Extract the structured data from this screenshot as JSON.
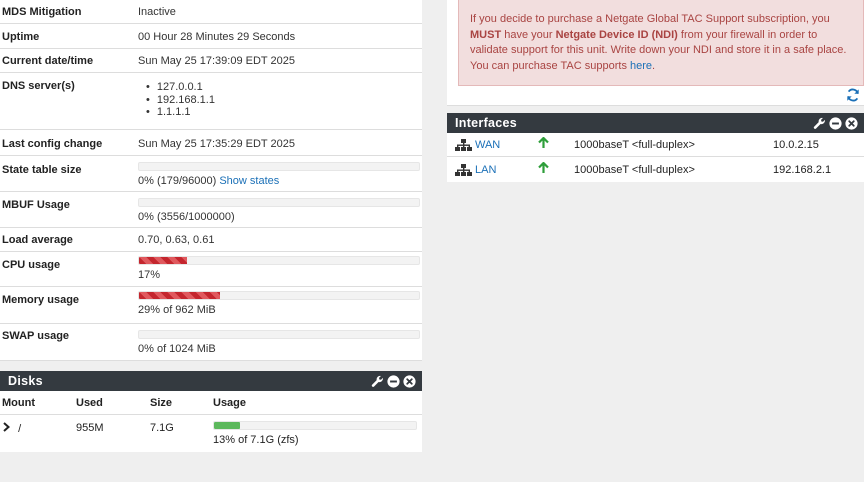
{
  "sysinfo": {
    "rows": [
      {
        "label": "MDS Mitigation",
        "value": "Inactive"
      },
      {
        "label": "Uptime",
        "value": "00 Hour 28 Minutes 29 Seconds"
      },
      {
        "label": "Current date/time",
        "value": "Sun May 25 17:39:09 EDT 2025"
      },
      {
        "label": "DNS server(s)",
        "dns": [
          "127.0.0.1",
          "192.168.1.1",
          "1.1.1.1"
        ]
      },
      {
        "label": "Last config change",
        "value": "Sun May 25 17:35:29 EDT 2025"
      },
      {
        "label": "State table size",
        "value": "0% (179/96000)",
        "link": "Show states",
        "fraction": 0.0
      },
      {
        "label": "MBUF Usage",
        "value": "0% (3556/1000000)",
        "fraction": 0.0
      },
      {
        "label": "Load average",
        "value": "0.70, 0.63, 0.61"
      },
      {
        "label": "CPU usage",
        "value": "17%",
        "fraction": 0.17
      },
      {
        "label": "Memory usage",
        "value": "29% of 962 MiB",
        "fraction": 0.29
      },
      {
        "label": "SWAP usage",
        "value": "0% of 1024 MiB",
        "fraction": 0.0
      }
    ]
  },
  "disks": {
    "title": "Disks",
    "columns": [
      "Mount",
      "Used",
      "Size",
      "Usage"
    ],
    "rows": [
      {
        "mount": "/",
        "used": "955M",
        "size": "7.1G",
        "usage_text": "13% of 7.1G (zfs)",
        "fraction": 0.13
      }
    ]
  },
  "notice": {
    "text_a": "If you decide to purchase a Netgate Global TAC Support subscription, you ",
    "must": "MUST",
    "text_b": " have your ",
    "ndi": "Netgate Device ID (NDI)",
    "text_c": " from your firewall in order to validate support for this unit. Write down your NDI and store it in a safe place. You can purchase TAC supports ",
    "link": "here",
    "text_d": "."
  },
  "interfaces": {
    "title": "Interfaces",
    "rows": [
      {
        "name": "WAN",
        "status": "up",
        "media": "1000baseT <full-duplex>",
        "ip": "10.0.2.15"
      },
      {
        "name": "LAN",
        "status": "up",
        "media": "1000baseT <full-duplex>",
        "ip": "192.168.2.1"
      }
    ]
  },
  "colors": {
    "panel_header": "#343a40",
    "alert_bg": "#f2dede",
    "alert_text": "#a94442",
    "link": "#1b70b7",
    "bar_red": "#c4262e",
    "bar_green": "#5cb85c",
    "status_up": "#2e9e3a"
  },
  "icons": {
    "wrench": "wrench-icon",
    "minus": "minus-circle-icon",
    "close": "close-circle-icon",
    "refresh": "refresh-icon",
    "network": "network-icon",
    "arrow_up": "arrow-up-icon",
    "chevron": "chevron-right-icon"
  }
}
